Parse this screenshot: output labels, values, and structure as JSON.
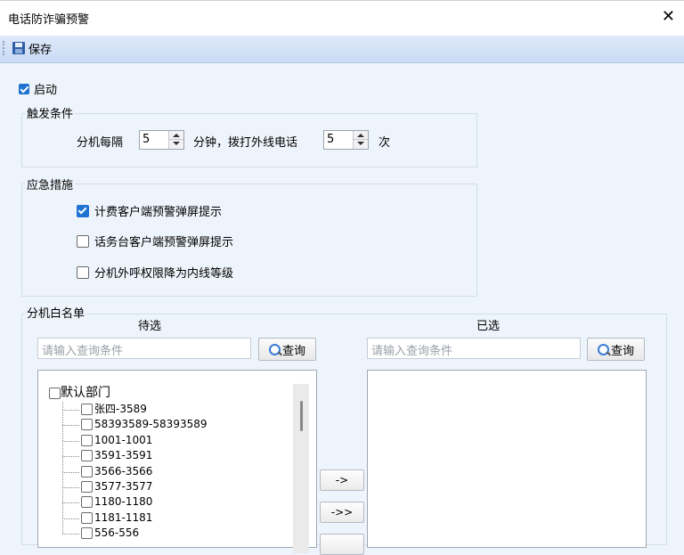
{
  "window": {
    "title": "电话防诈骗预警",
    "close_glyph": "✕"
  },
  "toolbar": {
    "save_label": "保存"
  },
  "enable": {
    "label": "启动",
    "checked": true
  },
  "trigger": {
    "legend": "触发条件",
    "prefix": "分机每隔",
    "interval_value": "5",
    "middle": "分钟，拨打外线电话",
    "count_value": "5",
    "suffix": "次"
  },
  "measures": {
    "legend": "应急措施",
    "options": [
      {
        "label": "计费客户端预警弹屏提示",
        "checked": true
      },
      {
        "label": "话务台客户端预警弹屏提示",
        "checked": false
      },
      {
        "label": "分机外呼权限降为内线等级",
        "checked": false
      }
    ]
  },
  "whitelist": {
    "legend": "分机白名单",
    "pending": {
      "header": "待选",
      "search_placeholder": "请输入查询条件",
      "search_button": "查询",
      "tree": {
        "root": "默认部门",
        "children": [
          "张四-3589",
          "58393589-58393589",
          "1001-1001",
          "3591-3591",
          "3566-3566",
          "3577-3577",
          "1180-1180",
          "1181-1181",
          "556-556"
        ]
      }
    },
    "selected": {
      "header": "已选",
      "search_placeholder": "请输入查询条件",
      "search_button": "查询"
    },
    "move_buttons": {
      "add": "->",
      "add_all": "->>"
    }
  }
}
